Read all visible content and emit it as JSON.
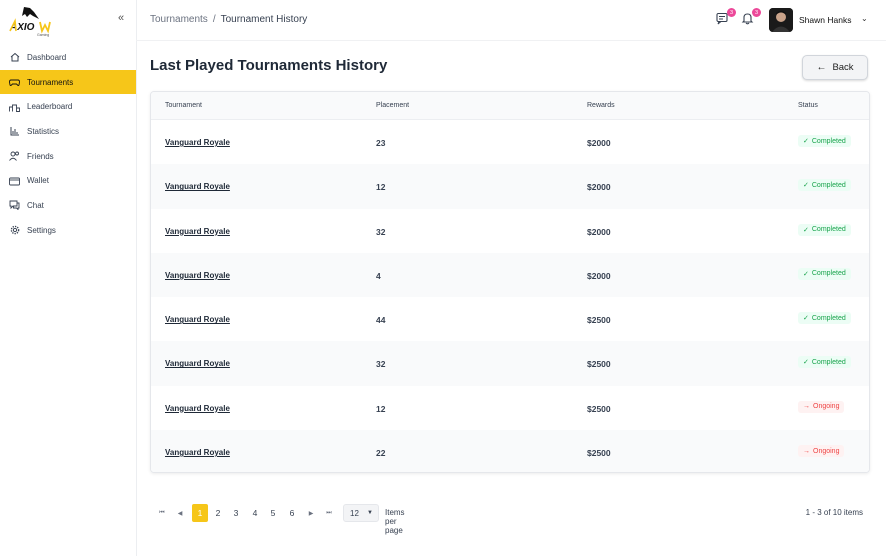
{
  "brand": {
    "name": "AXIOM",
    "sub": "Gaming"
  },
  "colors": {
    "accent": "#f6c619",
    "completed": "#16a34a",
    "ongoing": "#ef4444",
    "badge": "#ec4899"
  },
  "sidebar": {
    "items": [
      {
        "label": "Dashboard",
        "icon": "home-icon"
      },
      {
        "label": "Tournaments",
        "icon": "gamepad-icon",
        "active": true
      },
      {
        "label": "Leaderboard",
        "icon": "podium-icon"
      },
      {
        "label": "Statistics",
        "icon": "bar-chart-icon"
      },
      {
        "label": "Friends",
        "icon": "friends-icon"
      },
      {
        "label": "Wallet",
        "icon": "wallet-icon"
      },
      {
        "label": "Chat",
        "icon": "chat-icon"
      },
      {
        "label": "Settings",
        "icon": "gear-icon"
      }
    ]
  },
  "breadcrumb": {
    "parent": "Tournaments",
    "separator": "/",
    "current": "Tournament History"
  },
  "header": {
    "messages_count": "3",
    "notifications_count": "3",
    "user_name": "Shawn Hanks"
  },
  "page": {
    "title": "Last Played Tournaments History",
    "back_label": "Back"
  },
  "table": {
    "columns": [
      "Tournament",
      "Placement",
      "Rewards",
      "Status"
    ],
    "rows": [
      {
        "tournament": "Vanguard Royale",
        "placement": "23",
        "reward": "$2000",
        "status": "Completed"
      },
      {
        "tournament": "Vanguard Royale",
        "placement": "12",
        "reward": "$2000",
        "status": "Completed"
      },
      {
        "tournament": "Vanguard Royale",
        "placement": "32",
        "reward": "$2000",
        "status": "Completed"
      },
      {
        "tournament": "Vanguard Royale",
        "placement": "4",
        "reward": "$2000",
        "status": "Completed"
      },
      {
        "tournament": "Vanguard Royale",
        "placement": "44",
        "reward": "$2500",
        "status": "Completed"
      },
      {
        "tournament": "Vanguard Royale",
        "placement": "32",
        "reward": "$2500",
        "status": "Completed"
      },
      {
        "tournament": "Vanguard Royale",
        "placement": "12",
        "reward": "$2500",
        "status": "Ongoing"
      },
      {
        "tournament": "Vanguard Royale",
        "placement": "22",
        "reward": "$2500",
        "status": "Ongoing"
      }
    ]
  },
  "pagination": {
    "pages": [
      "1",
      "2",
      "3",
      "4",
      "5",
      "6"
    ],
    "current": "1",
    "per_page": "12",
    "per_page_label": "Items per page",
    "range_text": "1 - 3 of 10 items"
  }
}
